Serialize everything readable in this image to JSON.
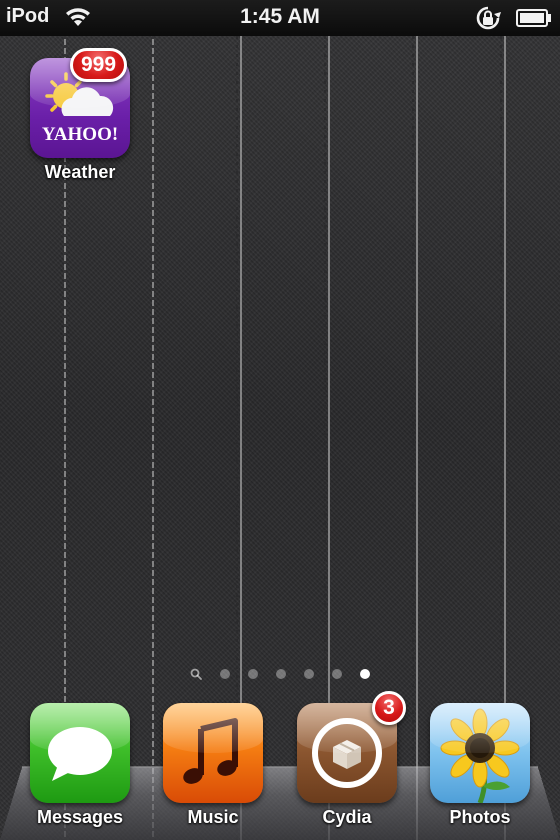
{
  "status_bar": {
    "carrier": "iPod",
    "time": "1:45 AM",
    "wifi_icon": "wifi-icon",
    "rotation_lock_icon": "rotation-lock-icon",
    "battery_icon": "battery-icon"
  },
  "home": {
    "apps": [
      {
        "label": "Weather",
        "badge": "999",
        "icon": "yahoo-weather-icon",
        "brand_text": "YAHOO!",
        "color": "#6a1fa8"
      }
    ]
  },
  "page_indicator": {
    "search_icon": "search-icon",
    "page_count": 6,
    "active_page": 6
  },
  "dock": {
    "apps": [
      {
        "label": "Messages",
        "badge": "",
        "icon": "speech-bubble-icon",
        "color": "#3fbf2a"
      },
      {
        "label": "Music",
        "badge": "",
        "icon": "music-note-icon",
        "color": "#f57d12"
      },
      {
        "label": "Cydia",
        "badge": "3",
        "icon": "cydia-box-icon",
        "color": "#8a552f"
      },
      {
        "label": "Photos",
        "badge": "",
        "icon": "sunflower-icon",
        "color": "#7ec2ee"
      }
    ]
  }
}
